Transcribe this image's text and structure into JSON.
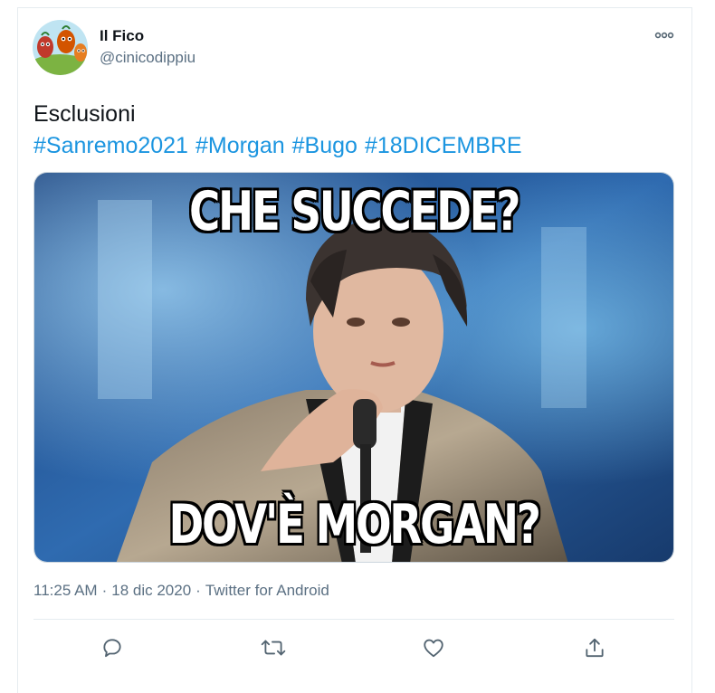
{
  "tweet": {
    "display_name": "Il Fico",
    "handle": "@cinicodippiu",
    "text": "Esclusioni",
    "hashtags": [
      "#Sanremo2021",
      "#Morgan",
      "#Bugo",
      "#18DICEMBRE"
    ],
    "media": {
      "caption_top": "CHE SUCCEDE?",
      "caption_bottom": "DOV'È MORGAN?"
    },
    "time": "11:25 AM",
    "date": "18 dic 2020",
    "source": "Twitter for Android",
    "separator": "·"
  },
  "actions": [
    "reply-icon",
    "retweet-icon",
    "like-icon",
    "share-icon"
  ],
  "colors": {
    "link": "#1b95e0",
    "secondary_text": "#5b7083",
    "icon": "#536471",
    "border": "#e6ecf0"
  }
}
